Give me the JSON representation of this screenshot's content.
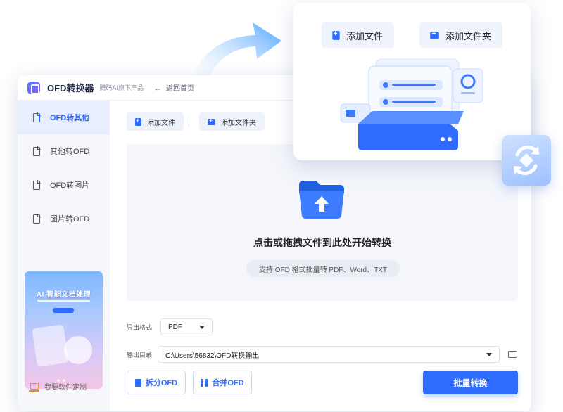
{
  "app": {
    "name": "OFD转换器",
    "subtitle": "腾码AI旗下产品",
    "back_label": "返回首页"
  },
  "sidebar": {
    "items": [
      {
        "label": "OFD转其他",
        "active": true,
        "icon": "document-icon"
      },
      {
        "label": "其他转OFD",
        "active": false,
        "icon": "document-icon"
      },
      {
        "label": "OFD转图片",
        "active": false,
        "icon": "document-icon"
      },
      {
        "label": "图片转OFD",
        "active": false,
        "icon": "document-icon"
      }
    ],
    "promo_title": "AI 智能文档处理",
    "custom_label": "我要软件定制"
  },
  "toolbar": {
    "add_file": "添加文件",
    "add_folder": "添加文件夹"
  },
  "dropzone": {
    "title": "点击或拖拽文件到此处开始转换",
    "hint": "支持 OFD 格式批量转 PDF、Word、TXT"
  },
  "output": {
    "format_label": "导出格式",
    "format_value": "PDF",
    "dir_label": "输出目录",
    "dir_value": "C:\\Users\\56832\\OFD转换输出"
  },
  "actions": {
    "split": "拆分OFD",
    "merge": "合并OFD",
    "convert": "批量转换"
  },
  "float_card": {
    "add_file": "添加文件",
    "add_folder": "添加文件夹"
  },
  "colors": {
    "accent": "#2f6bff",
    "sidebar_bg": "#f6f7fb",
    "active_bg": "#e8eefc",
    "dropzone_bg": "#f4f6fb"
  }
}
